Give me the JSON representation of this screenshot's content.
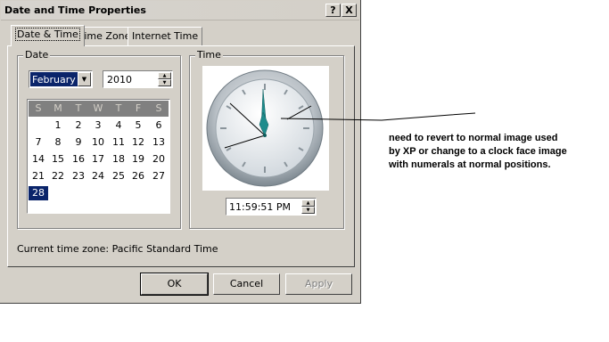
{
  "window": {
    "title": "Date and Time Properties",
    "help_label": "?",
    "close_label": "X"
  },
  "tabs": [
    {
      "label": "Date & Time",
      "active": true
    },
    {
      "label": "Time Zone",
      "active": false
    },
    {
      "label": "Internet Time",
      "active": false
    }
  ],
  "date_group": {
    "label": "Date",
    "month": "February",
    "month_options_visible": [
      "February"
    ],
    "year": "2010"
  },
  "calendar": {
    "day_names": [
      "S",
      "M",
      "T",
      "W",
      "T",
      "F",
      "S"
    ],
    "weeks": [
      [
        "",
        "1",
        "2",
        "3",
        "4",
        "5",
        "6"
      ],
      [
        "7",
        "8",
        "9",
        "10",
        "11",
        "12",
        "13"
      ],
      [
        "14",
        "15",
        "16",
        "17",
        "18",
        "19",
        "20"
      ],
      [
        "21",
        "22",
        "23",
        "24",
        "25",
        "26",
        "27"
      ],
      [
        "28",
        "",
        "",
        "",
        "",
        "",
        ""
      ]
    ],
    "selected_day": "28"
  },
  "time_group": {
    "label": "Time",
    "time": "11:59:51 PM"
  },
  "timezone_text": "Current time zone:  Pacific Standard Time",
  "buttons": {
    "ok": "OK",
    "cancel": "Cancel",
    "apply": "Apply"
  },
  "annotation": {
    "lines": [
      "need to revert to normal image used",
      "by XP or change to a clock face image",
      "with numerals at  normal positions."
    ]
  },
  "colors": {
    "dialog_bg": "#d4d0c8",
    "selection": "#0a246a",
    "clock_hand": "#1e8c8c"
  }
}
